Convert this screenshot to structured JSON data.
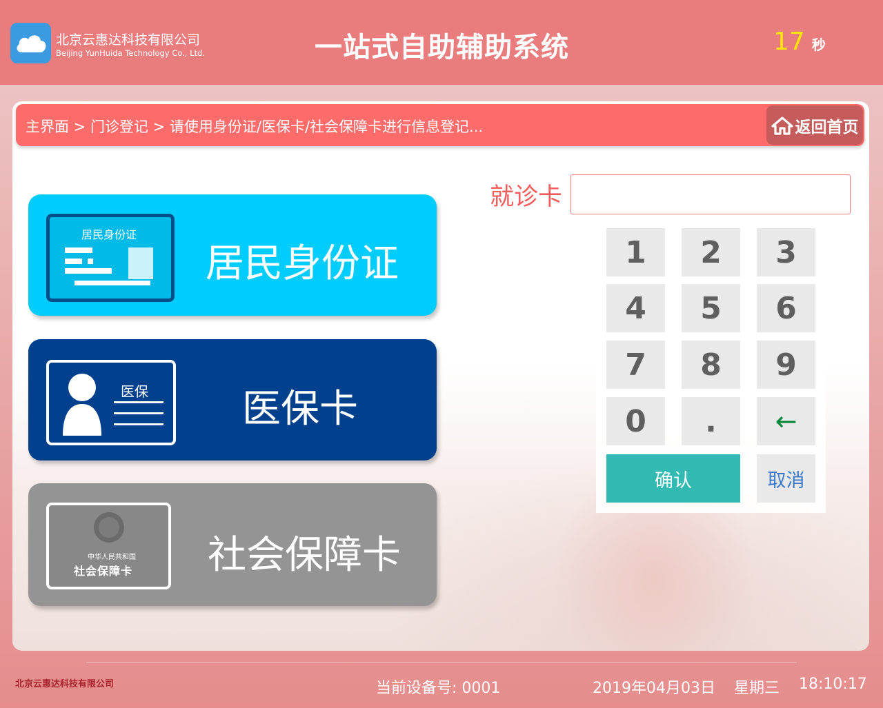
{
  "header": {
    "company_cn": "北京云惠达科技有限公司",
    "company_en": "Beijing YunHuida Technology Co., Ltd.",
    "logo_icon": "cloud-icon",
    "title": "一站式自助辅助系统",
    "countdown_value": "17",
    "countdown_unit": "秒"
  },
  "breadcrumb": {
    "path": "主界面 > 门诊登记 > 请使用身份证/医保卡/社会保障卡进行信息登记...",
    "home_label": "返回首页",
    "home_icon": "home-icon"
  },
  "card_options": {
    "id_card": {
      "label": "居民身份证",
      "card_title": "居民身份证"
    },
    "medical_card": {
      "label": "医保卡",
      "card_title": "医保"
    },
    "social_card": {
      "label": "社会保障卡",
      "card_subtitle": "中华人民共和国",
      "card_title": "社会保障卡"
    }
  },
  "input": {
    "label": "就诊卡",
    "value": ""
  },
  "keypad": {
    "keys": [
      "1",
      "2",
      "3",
      "4",
      "5",
      "6",
      "7",
      "8",
      "9",
      "0",
      ".",
      "←"
    ],
    "confirm_label": "确认",
    "cancel_label": "取消"
  },
  "footer": {
    "company": "北京云惠达科技有限公司",
    "device": "当前设备号: 0001",
    "date": "2019年04月03日",
    "weekday": "星期三",
    "time": "18:10:17"
  },
  "colors": {
    "header_bg": "#e97d7d",
    "breadcrumb_bg": "#fd6b6b",
    "id_button": "#00cdfd",
    "medical_button": "#00408d",
    "social_button": "#949494",
    "confirm_button": "#32b9b1",
    "countdown": "#ffe600"
  }
}
